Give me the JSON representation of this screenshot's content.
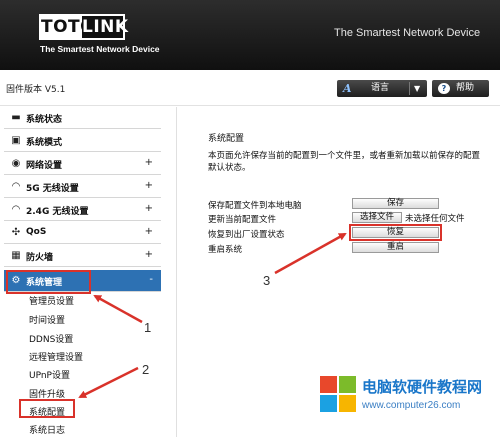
{
  "header": {
    "logo_left": "TOTO",
    "logo_right": "LINK",
    "logo_tagline": "The Smartest Network Device",
    "slogan": "The Smartest Network Device"
  },
  "toolbar": {
    "firmware": "固件版本 V5.1",
    "language_icon": "A",
    "language_label": "语言",
    "help_label": "帮助"
  },
  "sidebar": {
    "items": [
      {
        "label": "系统状态",
        "icon": "monitor-icon",
        "glyph": "▬"
      },
      {
        "label": "系统模式",
        "icon": "window-icon",
        "glyph": "▣"
      },
      {
        "label": "网络设置",
        "icon": "globe-icon",
        "glyph": "◉",
        "plus": "+"
      },
      {
        "label": "5G  无线设置",
        "icon": "wifi-icon",
        "glyph": "◠",
        "plus": "+"
      },
      {
        "label": "2.4G  无线设置",
        "icon": "wifi-icon",
        "glyph": "◠",
        "plus": "+"
      },
      {
        "label": "QoS",
        "icon": "qos-icon",
        "glyph": "✣",
        "plus": "+"
      },
      {
        "label": "防火墙",
        "icon": "firewall-icon",
        "glyph": "▦",
        "plus": "+"
      },
      {
        "label": "系统管理",
        "icon": "gear-icon",
        "glyph": "⚙",
        "plus": "-"
      }
    ],
    "sub_items": [
      "管理员设置",
      "时间设置",
      "DDNS设置",
      "远程管理设置",
      "UPnP设置",
      "固件升级",
      "系统配置",
      "系统日志"
    ]
  },
  "content": {
    "title": "系统配置",
    "desc_line1": "本页面允许保存当前的配置到一个文件里，或者重新加载以前保存的配置",
    "desc_line2": "默认状态。",
    "rows": [
      {
        "label": "保存配置文件到本地电脑",
        "button": "保存"
      },
      {
        "label": "更新当前配置文件",
        "button": "选择文件",
        "extra": "未选择任何文件"
      },
      {
        "label": "恢复到出厂设置状态",
        "button": "恢复"
      },
      {
        "label": "重启系统",
        "button": "重启"
      }
    ]
  },
  "annotations": {
    "n1": "1",
    "n2": "2",
    "n3": "3",
    "color": "#d9322a"
  },
  "watermark": {
    "title": "电脑软硬件教程网",
    "url": "www.computer26.com"
  },
  "colors": {
    "header_bg": "#1a1a1a",
    "active_menu": "#2d71b3",
    "annotation_red": "#d9322a"
  }
}
